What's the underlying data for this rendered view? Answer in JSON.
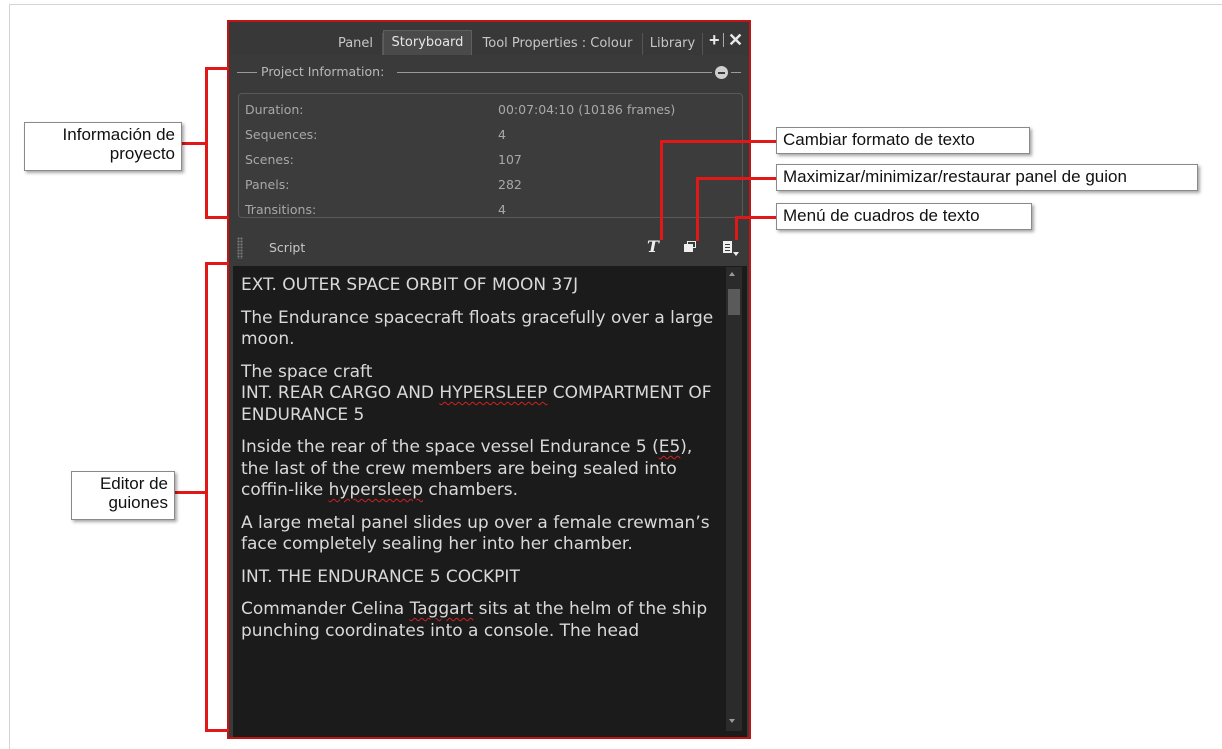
{
  "tabs": [
    {
      "label": "Panel",
      "active": false
    },
    {
      "label": "Storyboard",
      "active": true
    },
    {
      "label": "Tool Properties : Colour",
      "active": false
    },
    {
      "label": "Library",
      "active": false
    }
  ],
  "tab_actions": {
    "add_icon": "plus-icon",
    "close_icon": "close-icon"
  },
  "project_info": {
    "title": "Project Information:",
    "rows": [
      {
        "label": "Duration:",
        "value": "00:07:04:10   (10186 frames)"
      },
      {
        "label": "Sequences:",
        "value": "4"
      },
      {
        "label": "Scenes:",
        "value": "107"
      },
      {
        "label": "Panels:",
        "value": "282"
      },
      {
        "label": "Transitions:",
        "value": "4"
      }
    ]
  },
  "script_toolbar": {
    "label": "Script",
    "format_icon": "T"
  },
  "script_paragraphs": [
    "EXT. OUTER SPACE ORBIT OF MOON 37J",
    "The Endurance spacecraft floats gracefully over a large moon.",
    "The space craft\nINT. REAR CARGO AND HYPERSLEEP COMPARTMENT OF ENDURANCE 5",
    "Inside the rear of the space vessel Endurance 5 (E5), the last of the crew members are being sealed into coffin-like hypersleep chambers.",
    "A large metal panel slides up over a female crewman’s face completely sealing her into her chamber.",
    "INT. THE ENDURANCE 5 COCKPIT",
    "Commander Celina Taggart sits at the helm of the ship punching coordinates into a console. The head"
  ],
  "callouts": {
    "project_info": "Información de proyecto",
    "script_editor": "Editor de guiones",
    "change_format": "Cambiar formato de texto",
    "maximize": "Maximizar/minimizar/restaurar panel de guion",
    "text_menu": "Menú de cuadros de texto"
  },
  "colors": {
    "highlight": "#e01818",
    "panel_bg": "#3a3a3a",
    "editor_bg": "#1b1b1b"
  }
}
